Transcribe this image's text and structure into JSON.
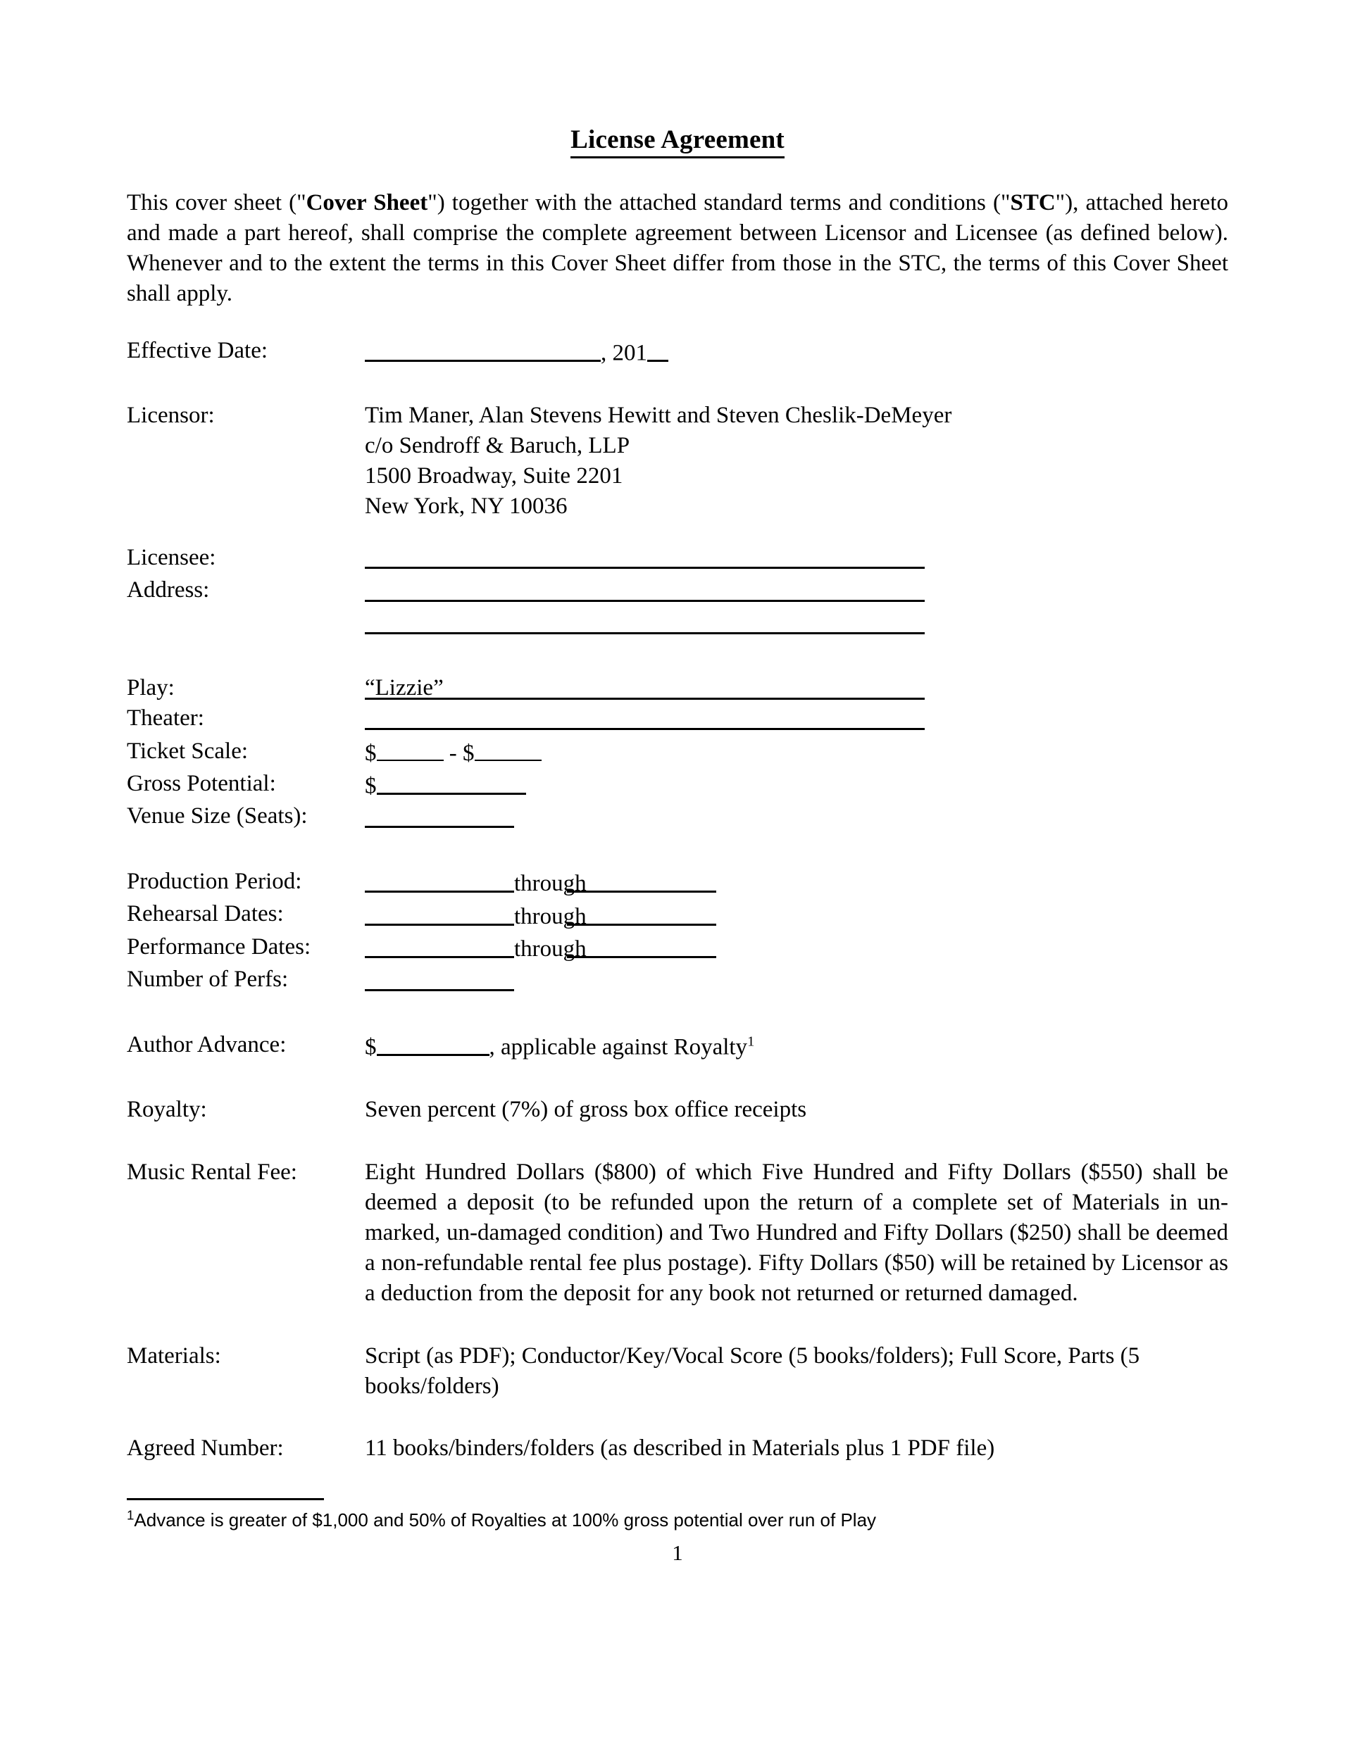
{
  "document": {
    "title": "License Agreement",
    "page_number": "1"
  },
  "intro": {
    "part1": "This cover sheet (\"",
    "bold1": "Cover Sheet",
    "part2": "\") together with the attached standard terms and conditions (\"",
    "bold2": "STC",
    "part3": "\"), attached hereto and made a part hereof, shall comprise the complete agreement between Licensor and Licensee (as defined below). Whenever and to the extent the terms in this Cover Sheet differ from those in the STC, the terms of this Cover Sheet shall apply."
  },
  "fields": {
    "effective_date": {
      "label": "Effective Date:",
      "year_prefix": ", 201"
    },
    "licensor": {
      "label": "Licensor:",
      "line1": "Tim Maner, Alan Stevens Hewitt and Steven Cheslik-DeMeyer",
      "line2": "c/o Sendroff & Baruch, LLP",
      "line3": "1500 Broadway, Suite 2201",
      "line4": "New York, NY 10036"
    },
    "licensee": {
      "label": "Licensee:"
    },
    "address": {
      "label": "Address:"
    },
    "play": {
      "label": "Play:",
      "value": "“Lizzie”"
    },
    "theater": {
      "label": "Theater:"
    },
    "ticket_scale": {
      "label": "Ticket Scale:",
      "dollar1": "$",
      "separator": " - ",
      "dollar2": "$"
    },
    "gross_potential": {
      "label": "Gross Potential:",
      "dollar": "$"
    },
    "venue_size": {
      "label": "Venue Size (Seats):"
    },
    "production_period": {
      "label": "Production Period:",
      "connector": "through"
    },
    "rehearsal_dates": {
      "label": "Rehearsal Dates:",
      "connector": "through"
    },
    "performance_dates": {
      "label": "Performance Dates:",
      "connector": "through"
    },
    "number_of_perfs": {
      "label": "Number of Perfs:"
    },
    "author_advance": {
      "label": "Author Advance:",
      "dollar": "$",
      "suffix": ", applicable against Royalty",
      "footnote_marker": "1"
    },
    "royalty": {
      "label": "Royalty:",
      "value": "Seven percent (7%) of gross box office receipts"
    },
    "music_rental_fee": {
      "label": "Music Rental Fee:",
      "value": "Eight Hundred Dollars ($800) of which Five Hundred and Fifty Dollars ($550) shall be deemed a deposit (to be refunded upon the return of a complete set of Materials in un-marked, un-damaged condition) and Two Hundred and Fifty Dollars ($250) shall be deemed a non-refundable rental fee plus postage). Fifty Dollars ($50) will be retained by Licensor as a deduction from the deposit for any book not returned or returned damaged."
    },
    "materials": {
      "label": "Materials:",
      "value": "Script (as PDF); Conductor/Key/Vocal Score (5 books/folders); Full Score, Parts (5 books/folders)"
    },
    "agreed_number": {
      "label": "Agreed Number:",
      "value": "11 books/binders/folders (as described in Materials plus 1 PDF file)"
    }
  },
  "footnote": {
    "marker": "1",
    "text": "Advance is greater of $1,000 and 50% of Royalties at 100% gross potential over run of Play"
  }
}
